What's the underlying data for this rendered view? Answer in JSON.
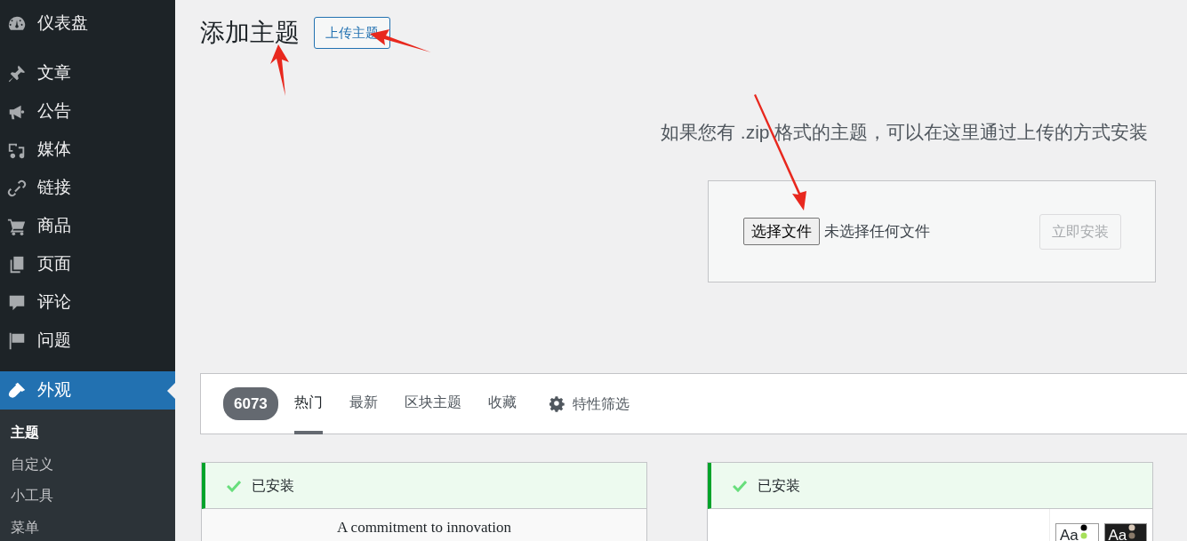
{
  "sidebar": {
    "groups": [
      {
        "items": [
          {
            "label": "仪表盘",
            "selected": false
          }
        ]
      },
      {
        "items": [
          {
            "label": "文章",
            "selected": false
          },
          {
            "label": "公告",
            "selected": false
          },
          {
            "label": "媒体",
            "selected": false
          },
          {
            "label": "链接",
            "selected": false
          },
          {
            "label": "商品",
            "selected": false
          },
          {
            "label": "页面",
            "selected": false
          },
          {
            "label": "评论",
            "selected": false
          },
          {
            "label": "问题",
            "selected": false
          }
        ]
      },
      {
        "items": [
          {
            "label": "外观",
            "selected": true,
            "children": [
              {
                "label": "主题",
                "selected": true
              },
              {
                "label": "自定义",
                "selected": false
              },
              {
                "label": "小工具",
                "selected": false
              },
              {
                "label": "菜单",
                "selected": false
              }
            ]
          }
        ]
      }
    ]
  },
  "header": {
    "title": "添加主题",
    "upload_button": "上传主题"
  },
  "upload": {
    "description": "如果您有 .zip 格式的主题，可以在这里通过上传的方式安装",
    "file_button": "选择文件",
    "file_status": "未选择任何文件",
    "install_button": {
      "label": "立即安装",
      "disabled": true
    }
  },
  "filter_bar": {
    "count": "6073",
    "tabs": [
      {
        "label": "热门",
        "selected": true
      },
      {
        "label": "最新",
        "selected": false
      },
      {
        "label": "区块主题",
        "selected": false
      },
      {
        "label": "收藏",
        "selected": false
      }
    ],
    "feature_filter": "特性筛选"
  },
  "themes": [
    {
      "status": "已安装",
      "installed": true,
      "preview_text": "A commitment to innovation"
    },
    {
      "status": "已安装",
      "installed": true,
      "preview_swatches": [
        "Aa",
        "Aa"
      ]
    }
  ]
}
